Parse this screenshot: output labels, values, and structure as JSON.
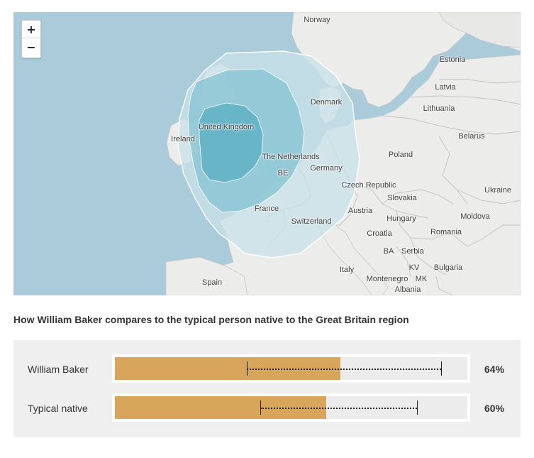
{
  "map": {
    "zoom_in_label": "+",
    "zoom_out_label": "−",
    "countries": [
      {
        "label": "Norway"
      },
      {
        "label": "Estonia"
      },
      {
        "label": "Latvia"
      },
      {
        "label": "Lithuania"
      },
      {
        "label": "Denmark"
      },
      {
        "label": "Belarus"
      },
      {
        "label": "United Kingdom"
      },
      {
        "label": "Ireland"
      },
      {
        "label": "Poland"
      },
      {
        "label": "The Netherlands"
      },
      {
        "label": "Germany"
      },
      {
        "label": "BE"
      },
      {
        "label": "Czech Republic"
      },
      {
        "label": "Ukraine"
      },
      {
        "label": "Slovakia"
      },
      {
        "label": "France"
      },
      {
        "label": "Austria"
      },
      {
        "label": "Hungary"
      },
      {
        "label": "Moldova"
      },
      {
        "label": "Switzerland"
      },
      {
        "label": "Croatia"
      },
      {
        "label": "Romania"
      },
      {
        "label": "BA"
      },
      {
        "label": "Serbia"
      },
      {
        "label": "KV"
      },
      {
        "label": "Bulgaria"
      },
      {
        "label": "Italy"
      },
      {
        "label": "Montenegro"
      },
      {
        "label": "MK"
      },
      {
        "label": "Albania"
      },
      {
        "label": "Spain"
      }
    ],
    "colors": {
      "water": "#aacbd9",
      "land": "#ececea",
      "border": "#c2c2c2",
      "region_outer": "#c8e2e8",
      "region_mid": "#84c3d1",
      "region_inner": "#5aaec3"
    }
  },
  "caption": "How William Baker compares to the typical person native to the Great Britain region",
  "comparison": {
    "rows": [
      {
        "label": "William Baker",
        "percent_label": "64%",
        "value": 0.64,
        "range_low": 0.375,
        "range_high": 0.925
      },
      {
        "label": "Typical native",
        "percent_label": "60%",
        "value": 0.6,
        "range_low": 0.412,
        "range_high": 0.858
      }
    ],
    "colors": {
      "fill": "#d8a65b",
      "track": "#ececec",
      "panel": "#efefef"
    }
  }
}
